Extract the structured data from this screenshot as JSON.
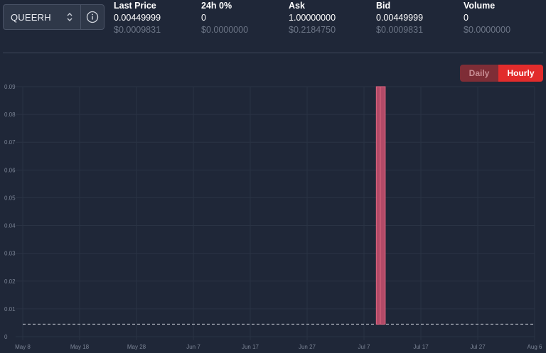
{
  "selector": {
    "pair": "QUEERH",
    "updown_icon": "chevron-up-down-icon",
    "info_icon": "info-circle-icon"
  },
  "stats": [
    {
      "label": "Last Price",
      "value": "0.00449999",
      "usd": "$0.0009831"
    },
    {
      "label": "24h 0%",
      "value": "0",
      "usd": "$0.0000000"
    },
    {
      "label": "Ask",
      "value": "1.00000000",
      "usd": "$0.2184750"
    },
    {
      "label": "Bid",
      "value": "0.00449999",
      "usd": "$0.0009831"
    },
    {
      "label": "Volume",
      "value": "0",
      "usd": "$0.0000000"
    }
  ],
  "toggle": {
    "daily": "Daily",
    "hourly": "Hourly",
    "active": "Hourly"
  },
  "colors": {
    "background": "#1f2738",
    "accent": "#e22c2c",
    "bar": "#b24a67",
    "muted": "#6d7687"
  },
  "chart_data": {
    "type": "bar",
    "ylim": [
      0,
      0.09
    ],
    "yticks": [
      "0",
      "0.01",
      "0.02",
      "0.03",
      "0.04",
      "0.05",
      "0.06",
      "0.07",
      "0.08",
      "0.09"
    ],
    "xticks": [
      "May 8",
      "May 18",
      "May 28",
      "Jun 7",
      "Jun 17",
      "Jun 27",
      "Jul 7",
      "Jul 17",
      "Jul 27",
      "Aug 6"
    ],
    "xrange": [
      0,
      90
    ],
    "reference_line": {
      "value": 0.00449999,
      "style": "dashed"
    },
    "bars": [
      {
        "x": 62.6,
        "low": 0.00449999,
        "high": 0.09
      },
      {
        "x": 63.3,
        "low": 0.00449999,
        "high": 0.09
      }
    ],
    "grid": true
  }
}
